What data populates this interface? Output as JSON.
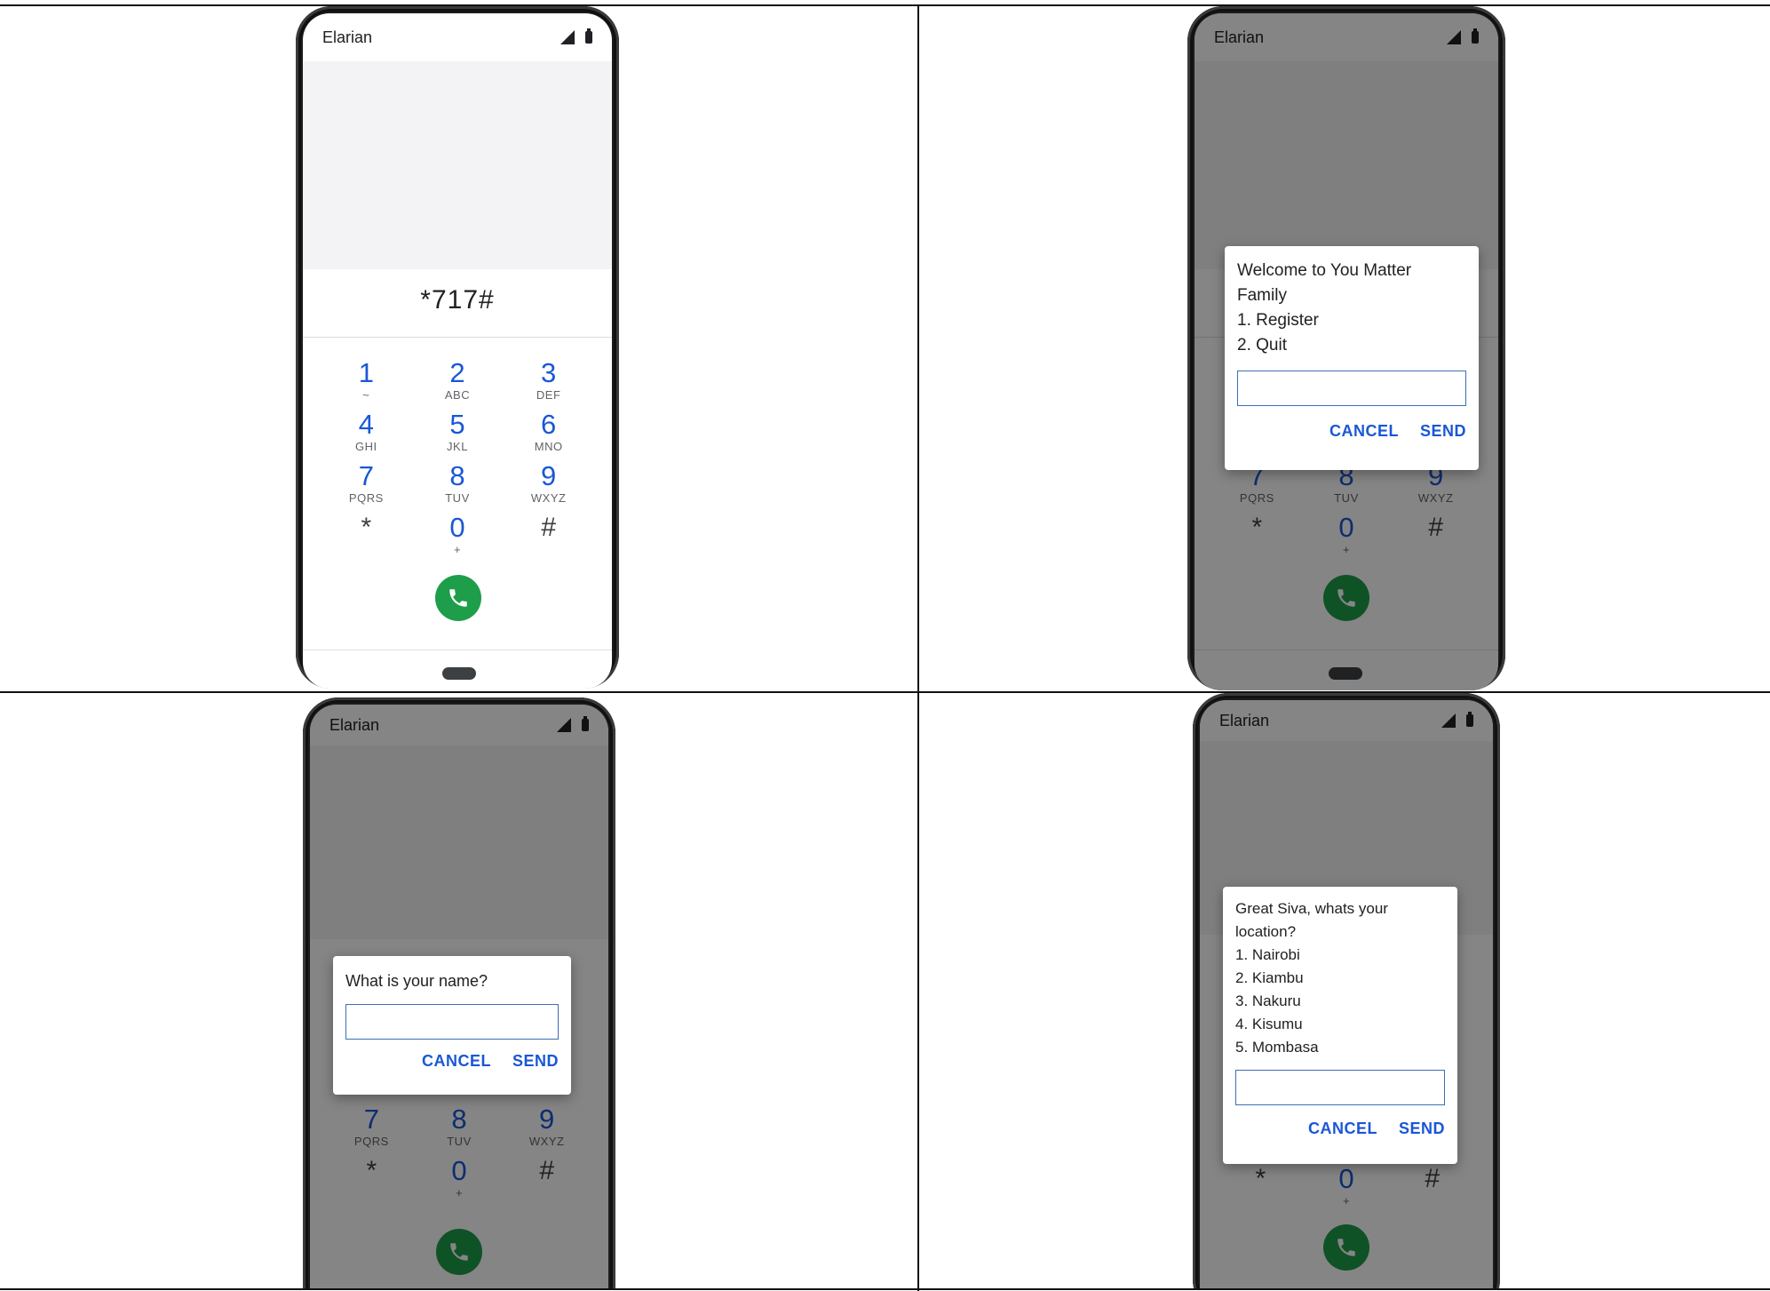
{
  "carrier": "Elarian",
  "panel1": {
    "dialed": "*717#",
    "keys": [
      {
        "digit": "1",
        "letters": "~"
      },
      {
        "digit": "2",
        "letters": "ABC"
      },
      {
        "digit": "3",
        "letters": "DEF"
      },
      {
        "digit": "4",
        "letters": "GHI"
      },
      {
        "digit": "5",
        "letters": "JKL"
      },
      {
        "digit": "6",
        "letters": "MNO"
      },
      {
        "digit": "7",
        "letters": "PQRS"
      },
      {
        "digit": "8",
        "letters": "TUV"
      },
      {
        "digit": "9",
        "letters": "WXYZ"
      },
      {
        "digit": "*",
        "letters": ""
      },
      {
        "digit": "0",
        "letters": "+"
      },
      {
        "digit": "#",
        "letters": ""
      }
    ]
  },
  "panel2": {
    "message": "Welcome to You Matter\nFamily\n1. Register\n2. Quit",
    "cancel": "CANCEL",
    "send": "SEND"
  },
  "panel3": {
    "message": "What is your name?",
    "cancel": "CANCEL",
    "send": "SEND"
  },
  "panel4": {
    "message": "Great Siva, whats your\nlocation?\n1. Nairobi\n2. Kiambu\n3. Nakuru\n4. Kisumu\n5. Mombasa",
    "cancel": "CANCEL",
    "send": "SEND"
  },
  "colors": {
    "accent": "#1a57d6",
    "call_green": "#1e9e4a",
    "dim_overlay": "rgba(0,0,0,0.48)"
  },
  "icons": {
    "signal": "signal-icon",
    "battery": "battery-icon",
    "call": "phone-icon"
  }
}
